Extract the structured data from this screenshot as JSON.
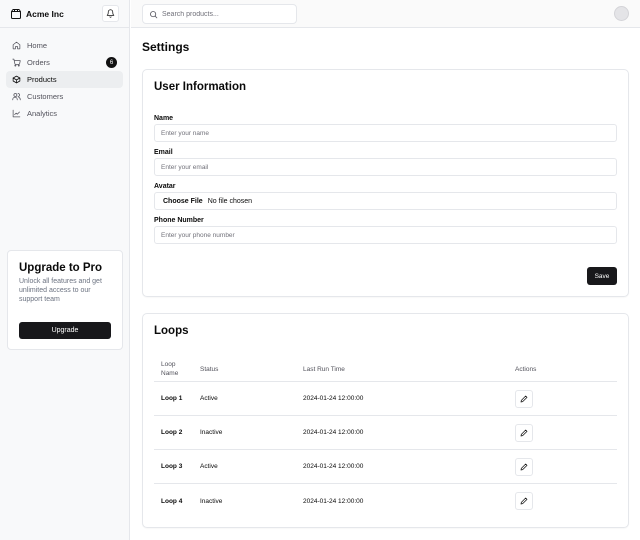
{
  "brand": {
    "name": "Acme Inc",
    "icon": "package-icon"
  },
  "sidebar": {
    "items": [
      {
        "label": "Home",
        "icon": "home-icon",
        "active": false
      },
      {
        "label": "Orders",
        "icon": "cart-icon",
        "badge": "6",
        "active": false
      },
      {
        "label": "Products",
        "icon": "box-icon",
        "active": true
      },
      {
        "label": "Customers",
        "icon": "users-icon",
        "active": false
      },
      {
        "label": "Analytics",
        "icon": "line-chart-icon",
        "active": false
      }
    ],
    "upgrade": {
      "title": "Upgrade to Pro",
      "description": "Unlock all features and get unlimited access to our support team",
      "button": "Upgrade"
    }
  },
  "header": {
    "search_placeholder": "Search products..."
  },
  "page": {
    "title": "Settings"
  },
  "user_info": {
    "title": "User Information",
    "fields": {
      "name": {
        "label": "Name",
        "placeholder": "Enter your name"
      },
      "email": {
        "label": "Email",
        "placeholder": "Enter your email"
      },
      "avatar": {
        "label": "Avatar",
        "button": "Choose File",
        "status": "No file chosen"
      },
      "phone": {
        "label": "Phone Number",
        "placeholder": "Enter your phone number"
      }
    },
    "save": "Save"
  },
  "loops": {
    "title": "Loops",
    "columns": {
      "name_line1": "Loop",
      "name_line2": "Name",
      "status": "Status",
      "last_run": "Last Run Time",
      "actions": "Actions"
    },
    "rows": [
      {
        "name": "Loop 1",
        "status": "Active",
        "last_run": "2024-01-24 12:00:00"
      },
      {
        "name": "Loop 2",
        "status": "Inactive",
        "last_run": "2024-01-24 12:00:00"
      },
      {
        "name": "Loop 3",
        "status": "Active",
        "last_run": "2024-01-24 12:00:00"
      },
      {
        "name": "Loop 4",
        "status": "Inactive",
        "last_run": "2024-01-24 12:00:00"
      }
    ]
  },
  "colors": {
    "primary": "#18181b",
    "border": "#e5e7eb",
    "sidebar_bg": "#f8f9fa",
    "muted_text": "#71717a"
  }
}
